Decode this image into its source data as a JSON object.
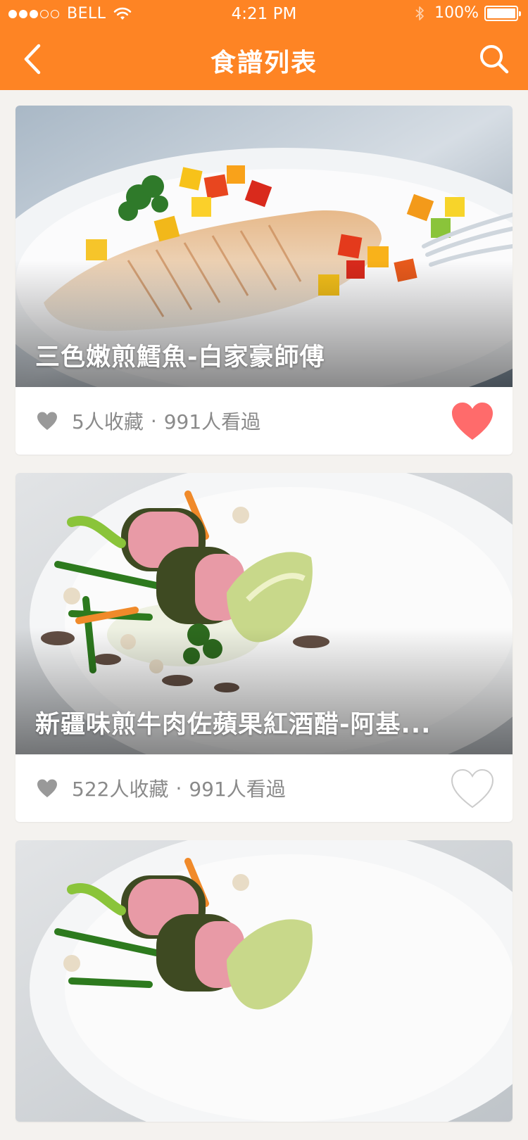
{
  "status_bar": {
    "carrier": "BELL",
    "time": "4:21 PM",
    "battery": "100%",
    "signal_bars_filled": 3,
    "signal_bars_total": 5
  },
  "nav": {
    "title": "食譜列表",
    "back_icon": "chevron-left-icon",
    "search_icon": "search-icon"
  },
  "colors": {
    "accent": "#fe8424",
    "favorite_active": "#ff6b6b",
    "favorite_inactive": "#cccccc"
  },
  "recipes": [
    {
      "title": "三色嫩煎鱈魚-白家豪師傅",
      "favorites": "5人收藏",
      "separator": "·",
      "views": "991人看過",
      "favorited": true
    },
    {
      "title": "新疆味煎牛肉佐蘋果紅酒醋-阿基...",
      "favorites": "522人收藏",
      "separator": "·",
      "views": "991人看過",
      "favorited": false
    },
    {
      "title": "",
      "favorites": "",
      "separator": "",
      "views": "",
      "favorited": false
    }
  ]
}
